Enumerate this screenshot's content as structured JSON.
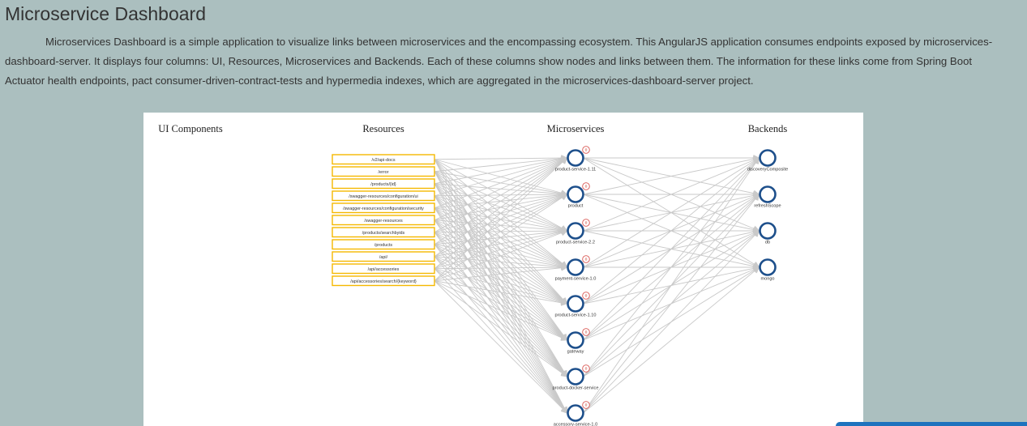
{
  "page": {
    "title": "Microservice Dashboard",
    "intro": "Microservices Dashboard is a simple application to visualize links between microservices and the encompassing ecosystem. This AngularJS application consumes endpoints exposed by microservices-dashboard-server. It displays four columns: UI, Resources, Microservices and Backends. Each of these columns show nodes and links between them. The information for these links come from Spring Boot Actuator health endpoints, pact consumer-driven-contract-tests and hypermedia indexes, which are aggregated in the microservices-dashboard-server project."
  },
  "graph": {
    "columns": [
      "UI Components",
      "Resources",
      "Microservices",
      "Backends"
    ],
    "resources": [
      "/v2/api-docs",
      "/error",
      "/products/{id}",
      "/swagger-resources/configuration/ui",
      "/swagger-resources/configuration/security",
      "/swagger-resources",
      "/products/searchbyids",
      "/products",
      "/api/",
      "/api/accessories",
      "/api/accessories/search/{keyword}"
    ],
    "microservices": [
      "product-service-1.11",
      "product",
      "product-service-2.2",
      "payment-service-1.0",
      "product-service-1.10",
      "gateway",
      "product-docker-service",
      "accessory-service-1.0"
    ],
    "backends": [
      "discoveryComposite",
      "refreshScope",
      "db",
      "mongo"
    ],
    "badge_label": "o",
    "colors": {
      "resource_border": "#f5b800",
      "node_ring": "#1d4f8b",
      "badge_ring": "#d9534f",
      "link": "#c9c9c9",
      "background": "#abbfbf"
    }
  }
}
